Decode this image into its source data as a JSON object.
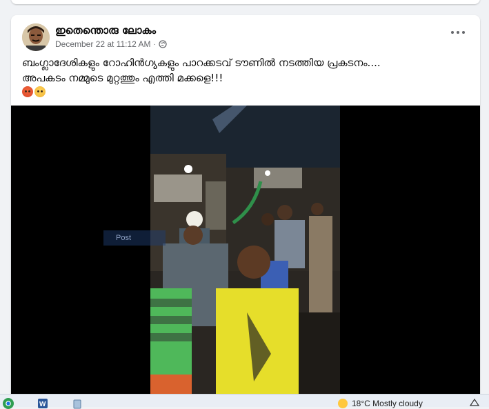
{
  "post": {
    "author": "ഇതെന്തൊരു ലോകം",
    "date": "December 22 at 11:12 AM",
    "separator": "·",
    "text_line1": "ബംഗ്ലാദേശികളും റോഹിൻഗ്യകളും  പാറക്കടവ് ടൗണിൽ നടത്തിയ പ്രകടനം....",
    "text_line2": "അപകടം നമ്മുടെ മുറ്റത്തും എത്തി മക്കളെ!!!",
    "reactions": [
      "angry-face-emoji",
      "frowning-face-emoji"
    ],
    "video_watermark": "Post"
  },
  "taskbar": {
    "weather": "18°C  Mostly cloudy"
  },
  "colors": {
    "page_bg": "#f0f2f5",
    "card_bg": "#ffffff",
    "meta_text": "#65676b",
    "video_bg": "#000000"
  }
}
